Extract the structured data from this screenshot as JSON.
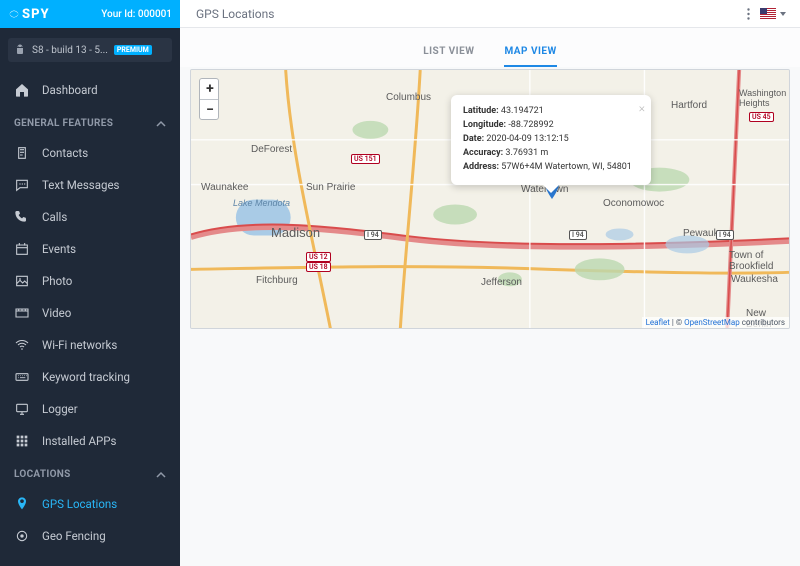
{
  "brand": "SPY",
  "user_id_label": "Your Id:",
  "user_id": "000001",
  "device": {
    "name": "S8 - build 13 - 5...",
    "badge": "PREMIUM"
  },
  "sidebar": {
    "dashboard": "Dashboard",
    "sections": {
      "general": "GENERAL FEATURES",
      "locations": "LOCATIONS"
    },
    "general_items": [
      {
        "label": "Contacts",
        "icon": "clipboard"
      },
      {
        "label": "Text Messages",
        "icon": "chat"
      },
      {
        "label": "Calls",
        "icon": "phone"
      },
      {
        "label": "Events",
        "icon": "calendar"
      },
      {
        "label": "Photo",
        "icon": "image"
      },
      {
        "label": "Video",
        "icon": "film"
      },
      {
        "label": "Wi-Fi networks",
        "icon": "wifi"
      },
      {
        "label": "Keyword tracking",
        "icon": "keyboard"
      },
      {
        "label": "Logger",
        "icon": "monitor"
      },
      {
        "label": "Installed APPs",
        "icon": "apps"
      }
    ],
    "location_items": [
      {
        "label": "GPS Locations",
        "icon": "pin",
        "active": true
      },
      {
        "label": "Geo Fencing",
        "icon": "target"
      }
    ]
  },
  "page": {
    "title": "GPS Locations"
  },
  "tabs": {
    "list": "LIST VIEW",
    "map": "MAP VIEW"
  },
  "map": {
    "zoom_in": "+",
    "zoom_out": "−",
    "attribution": {
      "leaflet": "Leaflet",
      "sep": " | © ",
      "osm": "OpenStreetMap",
      "tail": " contributors"
    },
    "cities": {
      "madison": "Madison",
      "fitchburg": "Fitchburg",
      "waunakee": "Waunakee",
      "deforest": "DeForest",
      "sunprairie": "Sun Prairie",
      "columbus": "Columbus",
      "watertown": "Watertown",
      "jefferson": "Jefferson",
      "oconomowoc": "Oconomowoc",
      "waukesha": "Waukesha",
      "pewaukee": "Pewaukee",
      "newberlin": "New Berlin",
      "hartford": "Hartford",
      "brookfield": "Town of Brookfield",
      "washingtonhts": "Washington Heights",
      "lakemendota": "Lake Mendota"
    },
    "shields": {
      "us151a": "US 151",
      "us12": "US 12",
      "us18": "US 18",
      "i94a": "I 94",
      "i94b": "I 94",
      "i94c": "I 94",
      "us45": "US 45"
    }
  },
  "popup": {
    "lat_label": "Latitude:",
    "lat": "43.194721",
    "lon_label": "Longitude:",
    "lon": "-88.728992",
    "date_label": "Date:",
    "date": "2020-04-09 13:12:15",
    "acc_label": "Accuracy:",
    "acc": "3.76931 m",
    "addr_label": "Address:",
    "addr": "57W6+4M Watertown, WI, 54801"
  }
}
